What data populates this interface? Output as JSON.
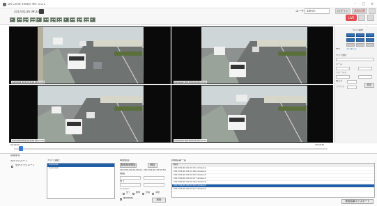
{
  "window": {
    "title": "DR Client Viewer Ver. 5.0.1",
    "minimize": "–",
    "maximize": "□",
    "close": "×"
  },
  "toolbar": {
    "datetime": "2017/01/16 09:23:00",
    "user_label": "ユーザー名",
    "user_value": "admin",
    "top_buttons": [
      "ログイン",
      "画面切替",
      ""
    ]
  },
  "live_button": "LIVE",
  "videos": [
    {
      "timestamp": "Camera1 2017/01/16 09:23:00"
    },
    {
      "timestamp": "Camera2 2017/01/16 09:23:00"
    },
    {
      "timestamp": "Camera3 2017/01/16 09:23:00"
    },
    {
      "timestamp": "Camera4 2017/01/16 09:23:00"
    }
  ],
  "right_panel": {
    "title": "カメラ操作",
    "ptz_label": "PTZ",
    "preset_label": "プリセット",
    "field_labels": [
      "カメラ選択",
      "ズーム",
      "フォーカス",
      "明るさ",
      "アイリス"
    ],
    "buttons": [
      "設定"
    ]
  },
  "scrubber": {
    "start": "00:00:00",
    "end": "23:59:59"
  },
  "bottom": {
    "section_title": "検索条件",
    "group_label": "カメラグループ",
    "all_groups_checkbox": "全カメラグループ",
    "camera_list_label": "カメラ選択",
    "camera_list": [
      "Camera1",
      "Camera2"
    ],
    "date_section_label": "時間指定",
    "search_button": "期間検索開始",
    "clear_button": "解除",
    "from_date": "2017/01/16 00:00:00",
    "to_date": "2017/01/16 23:59:59",
    "from_label": "開始",
    "to_label": "終了",
    "event_label": "イベント",
    "event_options": [
      "全て",
      "動体",
      "外部",
      "手動"
    ],
    "motion_checkbox": "動体検知",
    "execute_button": "検索",
    "results_label": "検索結果一覧",
    "results_header": "時刻",
    "results": [
      "2017/01/16 09:21:15 Camera1",
      "2017/01/16 09:21:48 Camera2",
      "2017/01/16 09:22:03 Camera3",
      "2017/01/16 09:22:27 Camera1",
      "2017/01/16 09:22:40 Camera4",
      "2017/01/16 09:23:00 Camera2",
      "2017/01/16 09:23:12 Camera3"
    ],
    "selected_result_index": 5,
    "export_button": "検索結果エクスポート"
  },
  "colors": {
    "accent": "#1f5fa8",
    "live": "#e24c4c"
  }
}
